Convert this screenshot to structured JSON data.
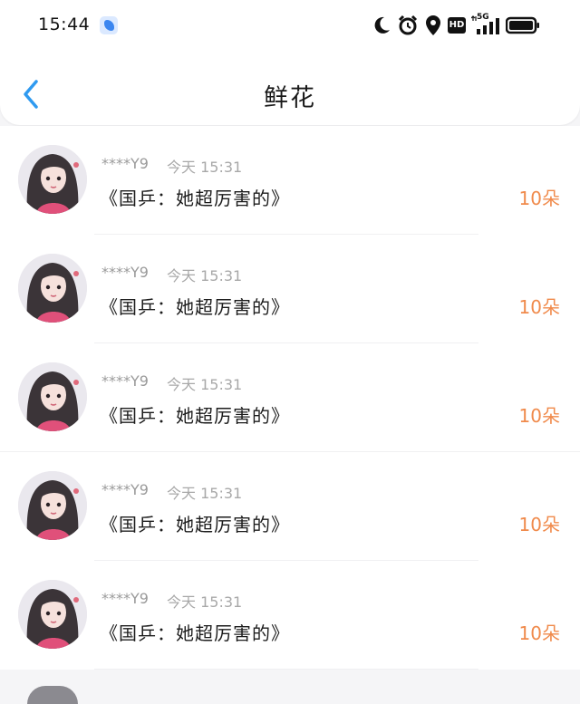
{
  "status_bar": {
    "time": "15:44",
    "app_icon": "feather-app-icon",
    "icons": [
      "moon-icon",
      "alarm-icon",
      "location-icon",
      "hd-icon",
      "5g-signal-icon",
      "battery-icon"
    ],
    "hd_label": "HD",
    "network_label": "5G"
  },
  "header": {
    "back_icon": "chevron-left-icon",
    "title": "鲜花"
  },
  "colors": {
    "accent_blue": "#2f9af0",
    "count_orange": "#f08a4b",
    "muted_gray": "#9a9a9a"
  },
  "items": [
    {
      "user": "****Y9",
      "time": "今天 15:31",
      "title": "《国乒：她超厉害的》",
      "count": "10朵"
    },
    {
      "user": "****Y9",
      "time": "今天 15:31",
      "title": "《国乒：她超厉害的》",
      "count": "10朵"
    },
    {
      "user": "****Y9",
      "time": "今天 15:31",
      "title": "《国乒：她超厉害的》",
      "count": "10朵"
    },
    {
      "user": "****Y9",
      "time": "今天 15:31",
      "title": "《国乒：她超厉害的》",
      "count": "10朵"
    },
    {
      "user": "****Y9",
      "time": "今天 15:31",
      "title": "《国乒：她超厉害的》",
      "count": "10朵"
    }
  ]
}
